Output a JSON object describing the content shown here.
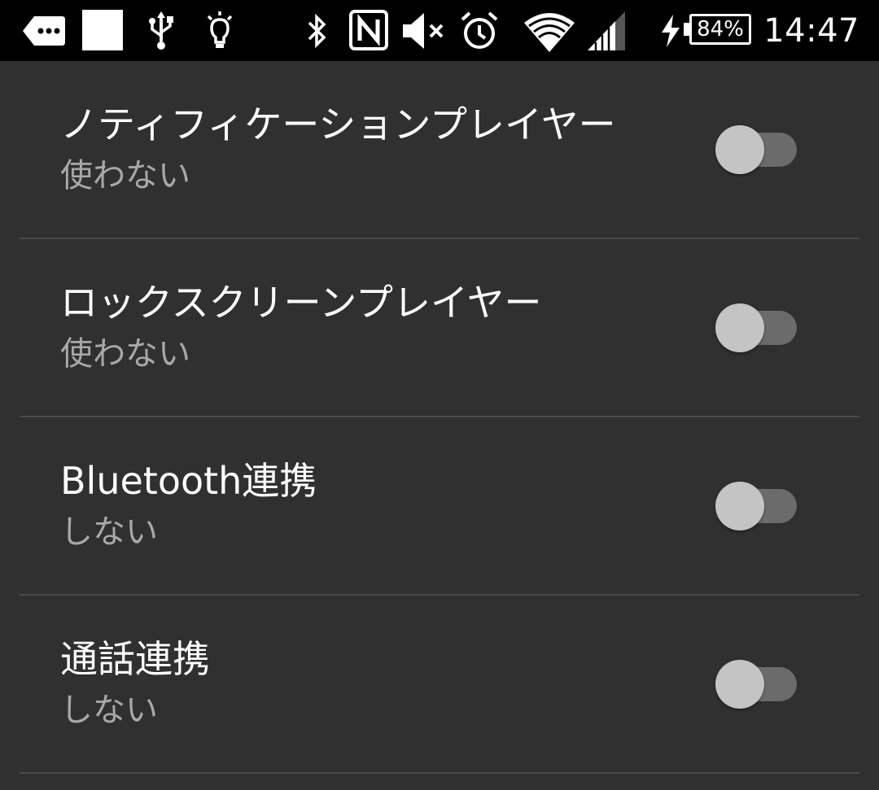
{
  "status_bar": {
    "time": "14:47",
    "battery_percent": "84%",
    "icons": [
      "more-notifications-icon",
      "blank-notification-icon",
      "usb-icon",
      "flashlight-icon",
      "bluetooth-icon",
      "nfc-icon",
      "mute-icon",
      "alarm-icon",
      "wifi-icon",
      "cell-signal-icon",
      "charging-icon",
      "battery-icon"
    ]
  },
  "settings": [
    {
      "title": "ノティフィケーションプレイヤー",
      "summary": "使わない",
      "enabled": false
    },
    {
      "title": "ロックスクリーンプレイヤー",
      "summary": "使わない",
      "enabled": false
    },
    {
      "title": "Bluetooth連携",
      "summary": "しない",
      "enabled": false
    },
    {
      "title": "通話連携",
      "summary": "しない",
      "enabled": false
    }
  ],
  "colors": {
    "background": "#303030",
    "status_bar": "#000000",
    "title_text": "#ffffff",
    "summary_text": "#a8a8a8",
    "divider": "#4a4a4a",
    "switch_track_off": "#6b6b6b",
    "switch_thumb_off": "#c4c4c4"
  }
}
